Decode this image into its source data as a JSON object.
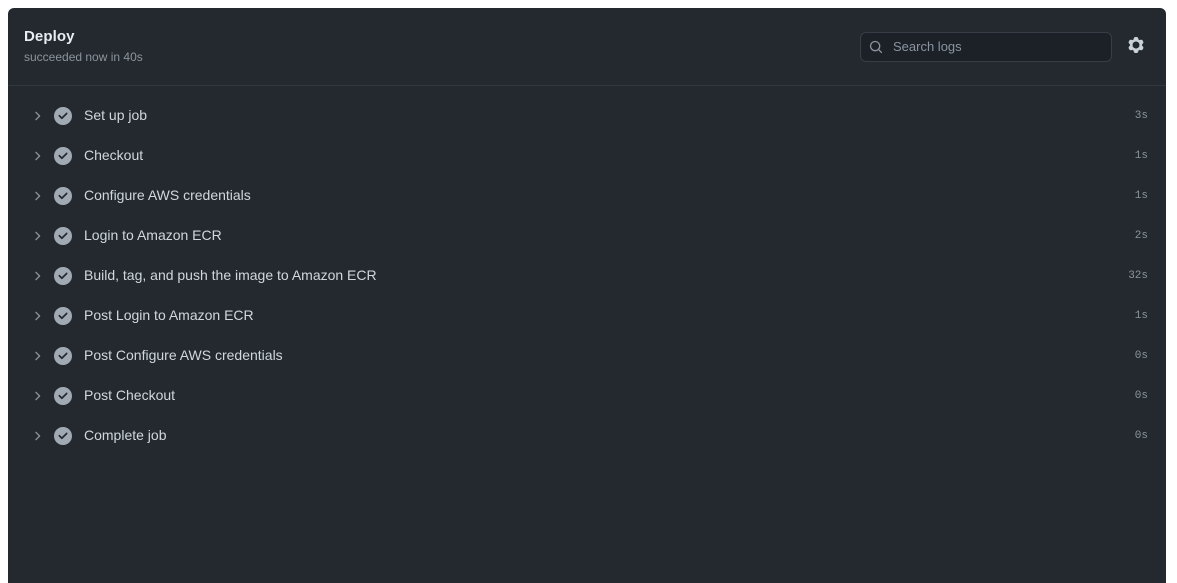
{
  "header": {
    "title": "Deploy",
    "status_text": "succeeded now in 40s",
    "search": {
      "placeholder": "Search logs",
      "value": "",
      "icon": "search-icon"
    },
    "settings": {
      "icon": "gear-icon",
      "label": "Settings"
    }
  },
  "colors": {
    "panel_bg": "#24292f",
    "page_bg": "#ffffff",
    "divider": "#32383f",
    "title_text": "#e6edf3",
    "muted_text": "#8b949e",
    "label_text": "#d0d7de",
    "status_success": "#a1a9b2",
    "search_bg": "#1c2128",
    "search_border": "#373e47"
  },
  "steps": [
    {
      "label": "Set up job",
      "duration": "3s",
      "status": "success",
      "expanded": false
    },
    {
      "label": "Checkout",
      "duration": "1s",
      "status": "success",
      "expanded": false
    },
    {
      "label": "Configure AWS credentials",
      "duration": "1s",
      "status": "success",
      "expanded": false
    },
    {
      "label": "Login to Amazon ECR",
      "duration": "2s",
      "status": "success",
      "expanded": false
    },
    {
      "label": "Build, tag, and push the image to Amazon ECR",
      "duration": "32s",
      "status": "success",
      "expanded": false
    },
    {
      "label": "Post Login to Amazon ECR",
      "duration": "1s",
      "status": "success",
      "expanded": false
    },
    {
      "label": "Post Configure AWS credentials",
      "duration": "0s",
      "status": "success",
      "expanded": false
    },
    {
      "label": "Post Checkout",
      "duration": "0s",
      "status": "success",
      "expanded": false
    },
    {
      "label": "Complete job",
      "duration": "0s",
      "status": "success",
      "expanded": false
    }
  ],
  "icons": {
    "chevron_right": "chevron-right-icon",
    "check_circle": "check-circle-icon"
  }
}
